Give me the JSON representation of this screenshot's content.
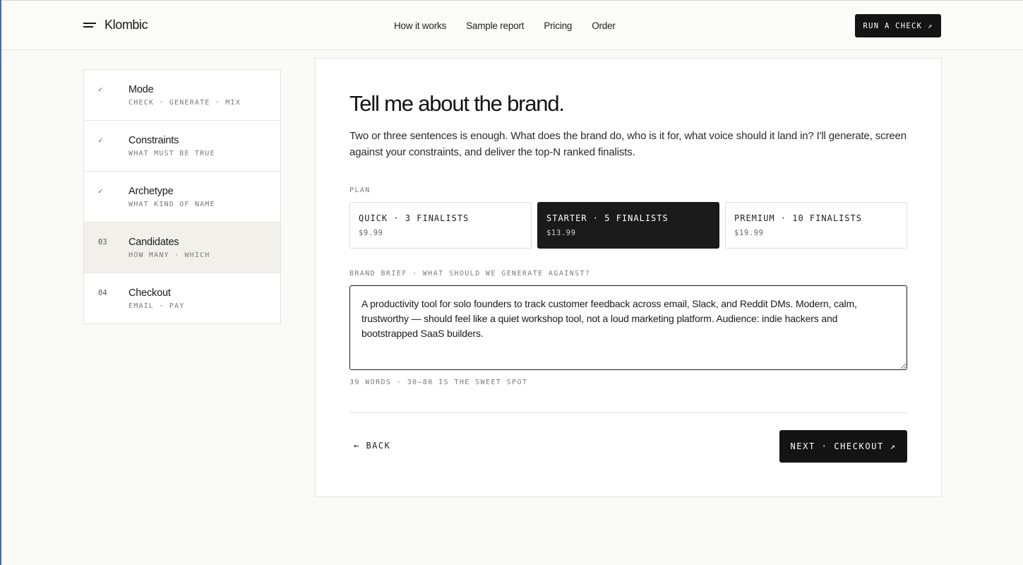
{
  "header": {
    "brand": "Klombic",
    "nav": [
      "How it works",
      "Sample report",
      "Pricing",
      "Order"
    ],
    "cta": "RUN A CHECK ↗"
  },
  "steps": [
    {
      "mark": "✓",
      "title": "Mode",
      "sub": "CHECK · GENERATE · MIX",
      "state": "done"
    },
    {
      "mark": "✓",
      "title": "Constraints",
      "sub": "WHAT MUST BE TRUE",
      "state": "done"
    },
    {
      "mark": "✓",
      "title": "Archetype",
      "sub": "WHAT KIND OF NAME",
      "state": "done"
    },
    {
      "mark": "03",
      "title": "Candidates",
      "sub": "HOW MANY · WHICH",
      "state": "active"
    },
    {
      "mark": "04",
      "title": "Checkout",
      "sub": "EMAIL · PAY",
      "state": "pending"
    }
  ],
  "main": {
    "title": "Tell me about the brand.",
    "intro": "Two or three sentences is enough. What does the brand do, who is it for, what voice should it land in? I'll generate, screen against your constraints, and deliver the top-N ranked finalists.",
    "plan_label": "PLAN",
    "plans": [
      {
        "name": "QUICK · 3 FINALISTS",
        "price": "$9.99",
        "selected": false
      },
      {
        "name": "STARTER · 5 FINALISTS",
        "price": "$13.99",
        "selected": true
      },
      {
        "name": "PREMIUM · 10 FINALISTS",
        "price": "$19.99",
        "selected": false
      }
    ],
    "brief_label": "BRAND BRIEF · WHAT SHOULD WE GENERATE AGAINST?",
    "brief_value": "A productivity tool for solo founders to track customer feedback across email, Slack, and Reddit DMs. Modern, calm, trustworthy — should feel like a quiet workshop tool, not a loud marketing platform. Audience: indie hackers and bootstrapped SaaS builders.",
    "word_count": "39 WORDS · 30–80 IS THE SWEET SPOT",
    "back_label": "← BACK",
    "next_label": "NEXT · CHECKOUT ↗"
  }
}
